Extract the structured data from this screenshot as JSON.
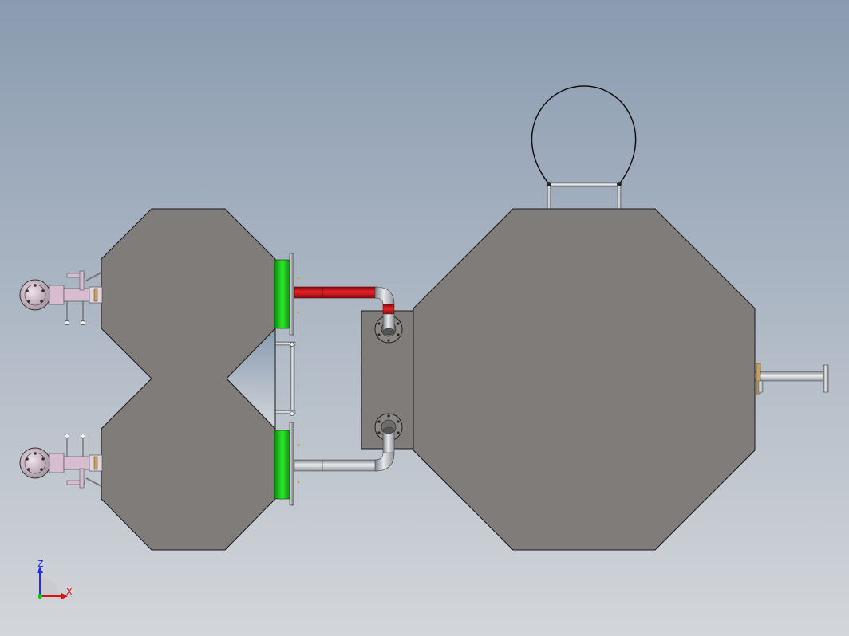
{
  "scene": {
    "type": "cad-assembly-front-view",
    "background_top": "#8a9bb0",
    "background_bottom": "#d3d6da",
    "vessel_color": "#7f7c79",
    "outline_color": "#1a1a1a",
    "pipe_gray": "#b9bcc0",
    "hot_pipe_red": "#c8141a",
    "flange_green": "#19c219",
    "gauge_pink": "#d8bcd0",
    "handle_color": "#111111"
  },
  "components": {
    "large_vessel": "large-octagonal-vessel",
    "small_vessels": [
      "upper-small-vessel",
      "lower-small-vessel"
    ],
    "junction_box": "junction-box",
    "hot_line": "red-hot-pipe",
    "return_line": "gray-return-pipe",
    "outlet": "outlet-pipe-right",
    "lifting_handle": "lifting-handle"
  },
  "triad": {
    "z_label": "Z",
    "x_label": "X",
    "z_color": "#1a2cff",
    "x_color": "#e01010"
  }
}
